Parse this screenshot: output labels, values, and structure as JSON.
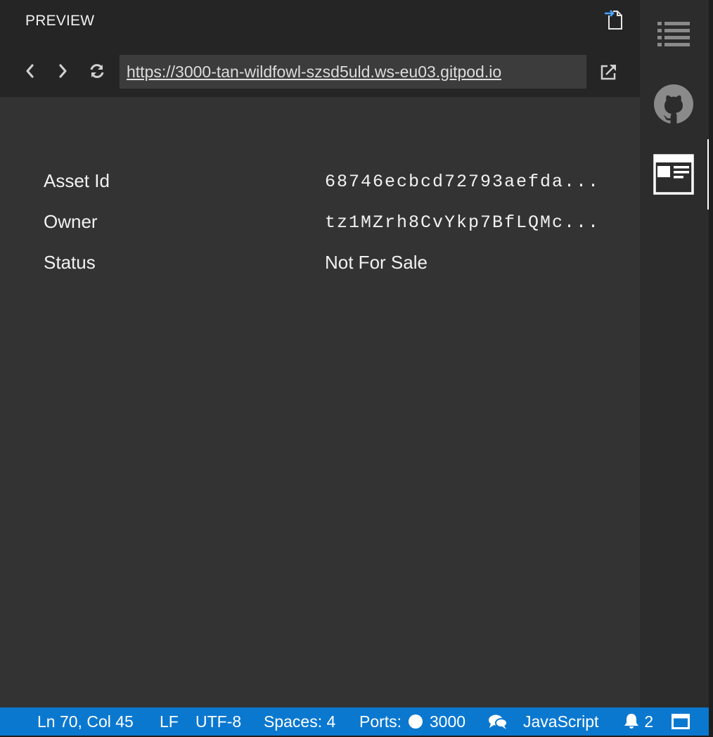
{
  "preview": {
    "title": "PREVIEW",
    "url": "https://3000-tan-wildfowl-szsd5uld.ws-eu03.gitpod.io"
  },
  "asset": {
    "rows": [
      {
        "label": "Asset Id",
        "value": "68746ecbcd72793aefda..."
      },
      {
        "label": "Owner",
        "value": "tz1MZrh8CvYkp7BfLQMc..."
      },
      {
        "label": "Status",
        "value": "Not For Sale"
      }
    ]
  },
  "statusbar": {
    "position": "Ln 70, Col 45",
    "eol": "LF",
    "encoding": "UTF-8",
    "spaces": "Spaces: 4",
    "ports_label": "Ports:",
    "port": "3000",
    "language": "JavaScript",
    "notifications": "2"
  },
  "icons": {
    "back": "chevron-left-icon",
    "forward": "chevron-right-icon",
    "refresh": "refresh-icon",
    "external": "external-link-icon",
    "open_to_side": "open-to-side-icon",
    "outline": "list-icon",
    "github": "github-icon",
    "preview": "browser-preview-icon",
    "feedback": "chat-icon",
    "bell": "bell-icon",
    "layout": "panel-layout-icon"
  },
  "colors": {
    "statusbar": "#0b78d0",
    "editor_bg": "#333333",
    "header_bg": "#252526",
    "activity_bg": "#2c2c2c"
  }
}
